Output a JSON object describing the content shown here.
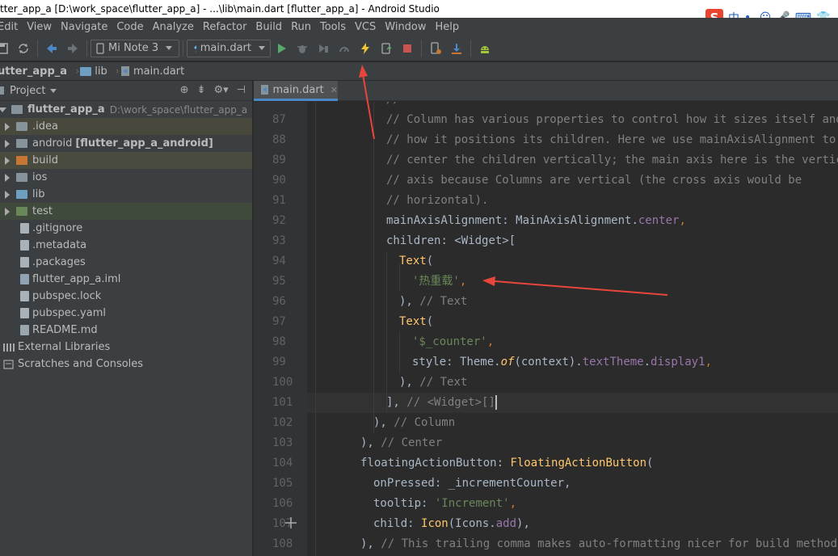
{
  "window": {
    "title": "tter_app_a [D:\\work_space\\flutter_app_a] - ...\\lib\\main.dart [flutter_app_a] - Android Studio"
  },
  "ime": {
    "logo": "S",
    "items": [
      "中",
      "•,",
      "☺",
      "🎤",
      "⌨",
      "👕"
    ]
  },
  "menu": [
    "Edit",
    "View",
    "Navigate",
    "Code",
    "Analyze",
    "Refactor",
    "Build",
    "Run",
    "Tools",
    "VCS",
    "Window",
    "Help"
  ],
  "toolbar": {
    "device": "Mi Note 3",
    "run_config": "main.dart"
  },
  "breadcrumb": [
    "utter_app_a",
    "lib",
    "main.dart"
  ],
  "project_panel": {
    "title": "Project",
    "tree": [
      {
        "label": "flutter_app_a",
        "path": "D:\\work_space\\flutter_app_a",
        "type": "root"
      },
      {
        "label": ".idea",
        "type": "folder"
      },
      {
        "label": "android",
        "extra": "[flutter_app_a_android]",
        "type": "folder"
      },
      {
        "label": "build",
        "type": "folder"
      },
      {
        "label": "ios",
        "type": "folder"
      },
      {
        "label": "lib",
        "type": "folder"
      },
      {
        "label": "test",
        "type": "folder"
      },
      {
        "label": ".gitignore",
        "type": "file"
      },
      {
        "label": ".metadata",
        "type": "file"
      },
      {
        "label": ".packages",
        "type": "file"
      },
      {
        "label": "flutter_app_a.iml",
        "type": "file"
      },
      {
        "label": "pubspec.lock",
        "type": "file"
      },
      {
        "label": "pubspec.yaml",
        "type": "file"
      },
      {
        "label": "README.md",
        "type": "file"
      },
      {
        "label": "External Libraries",
        "type": "lib"
      },
      {
        "label": "Scratches and Consoles",
        "type": "scratch"
      }
    ]
  },
  "editor": {
    "tab": "main.dart",
    "line_numbers": [
      "87",
      "88",
      "89",
      "90",
      "91",
      "92",
      "93",
      "94",
      "95",
      "96",
      "97",
      "98",
      "99",
      "100",
      "101",
      "102",
      "103",
      "104",
      "105",
      "106",
      "107",
      "108"
    ],
    "code": {
      "l87": "// Column has various properties to control how it sizes itself and",
      "l88": "// how it positions its children. Here we use mainAxisAlignment to",
      "l89": "// center the children vertically; the main axis here is the vertical",
      "l90": "// axis because Columns are vertical (the cross axis would be",
      "l91": "// horizontal).",
      "l92a": "mainAxisAlignment",
      "l92b": ": MainAxisAlignment.",
      "l92c": "center",
      "l92d": ",",
      "l93a": "children",
      "l93b": ": <Widget>[",
      "l94a": "Text",
      "l94b": "(",
      "l95a": "'热重载'",
      "l95b": ",",
      "l96a": "), ",
      "l96b": "// Text",
      "l97a": "Text",
      "l97b": "(",
      "l98a": "'$_counter'",
      "l98b": ",",
      "l99a": "style",
      "l99b": ": Theme.",
      "l99c": "of",
      "l99d": "(context).",
      "l99e": "textTheme",
      "l99f": ".",
      "l99g": "display1",
      "l99h": ",",
      "l100a": "), ",
      "l100b": "// Text",
      "l101a": "], ",
      "l101b": "// <Widget>[]",
      "l102a": "), ",
      "l102b": "// Column",
      "l103a": "), ",
      "l103b": "// Center",
      "l104a": "floatingActionButton",
      "l104b": ": ",
      "l104c": "FloatingActionButton",
      "l104d": "(",
      "l105a": "onPressed",
      "l105b": ": _incrementCounter,",
      "l106a": "tooltip",
      "l106b": ": ",
      "l106c": "'Increment'",
      "l106d": ",",
      "l107a": "child",
      "l107b": ": ",
      "l107c": "Icon",
      "l107d": "(Icons.",
      "l107e": "add",
      "l107f": "),",
      "l108a": "), ",
      "l108b": "// This trailing comma makes auto-formatting nicer for build methods. /"
    }
  },
  "colors": {
    "comment": "#808080",
    "keyword": "#cc7832",
    "string": "#6a8759",
    "property": "#9876aa",
    "function": "#ffc66d",
    "annotation_arrow": "#e8453c"
  }
}
